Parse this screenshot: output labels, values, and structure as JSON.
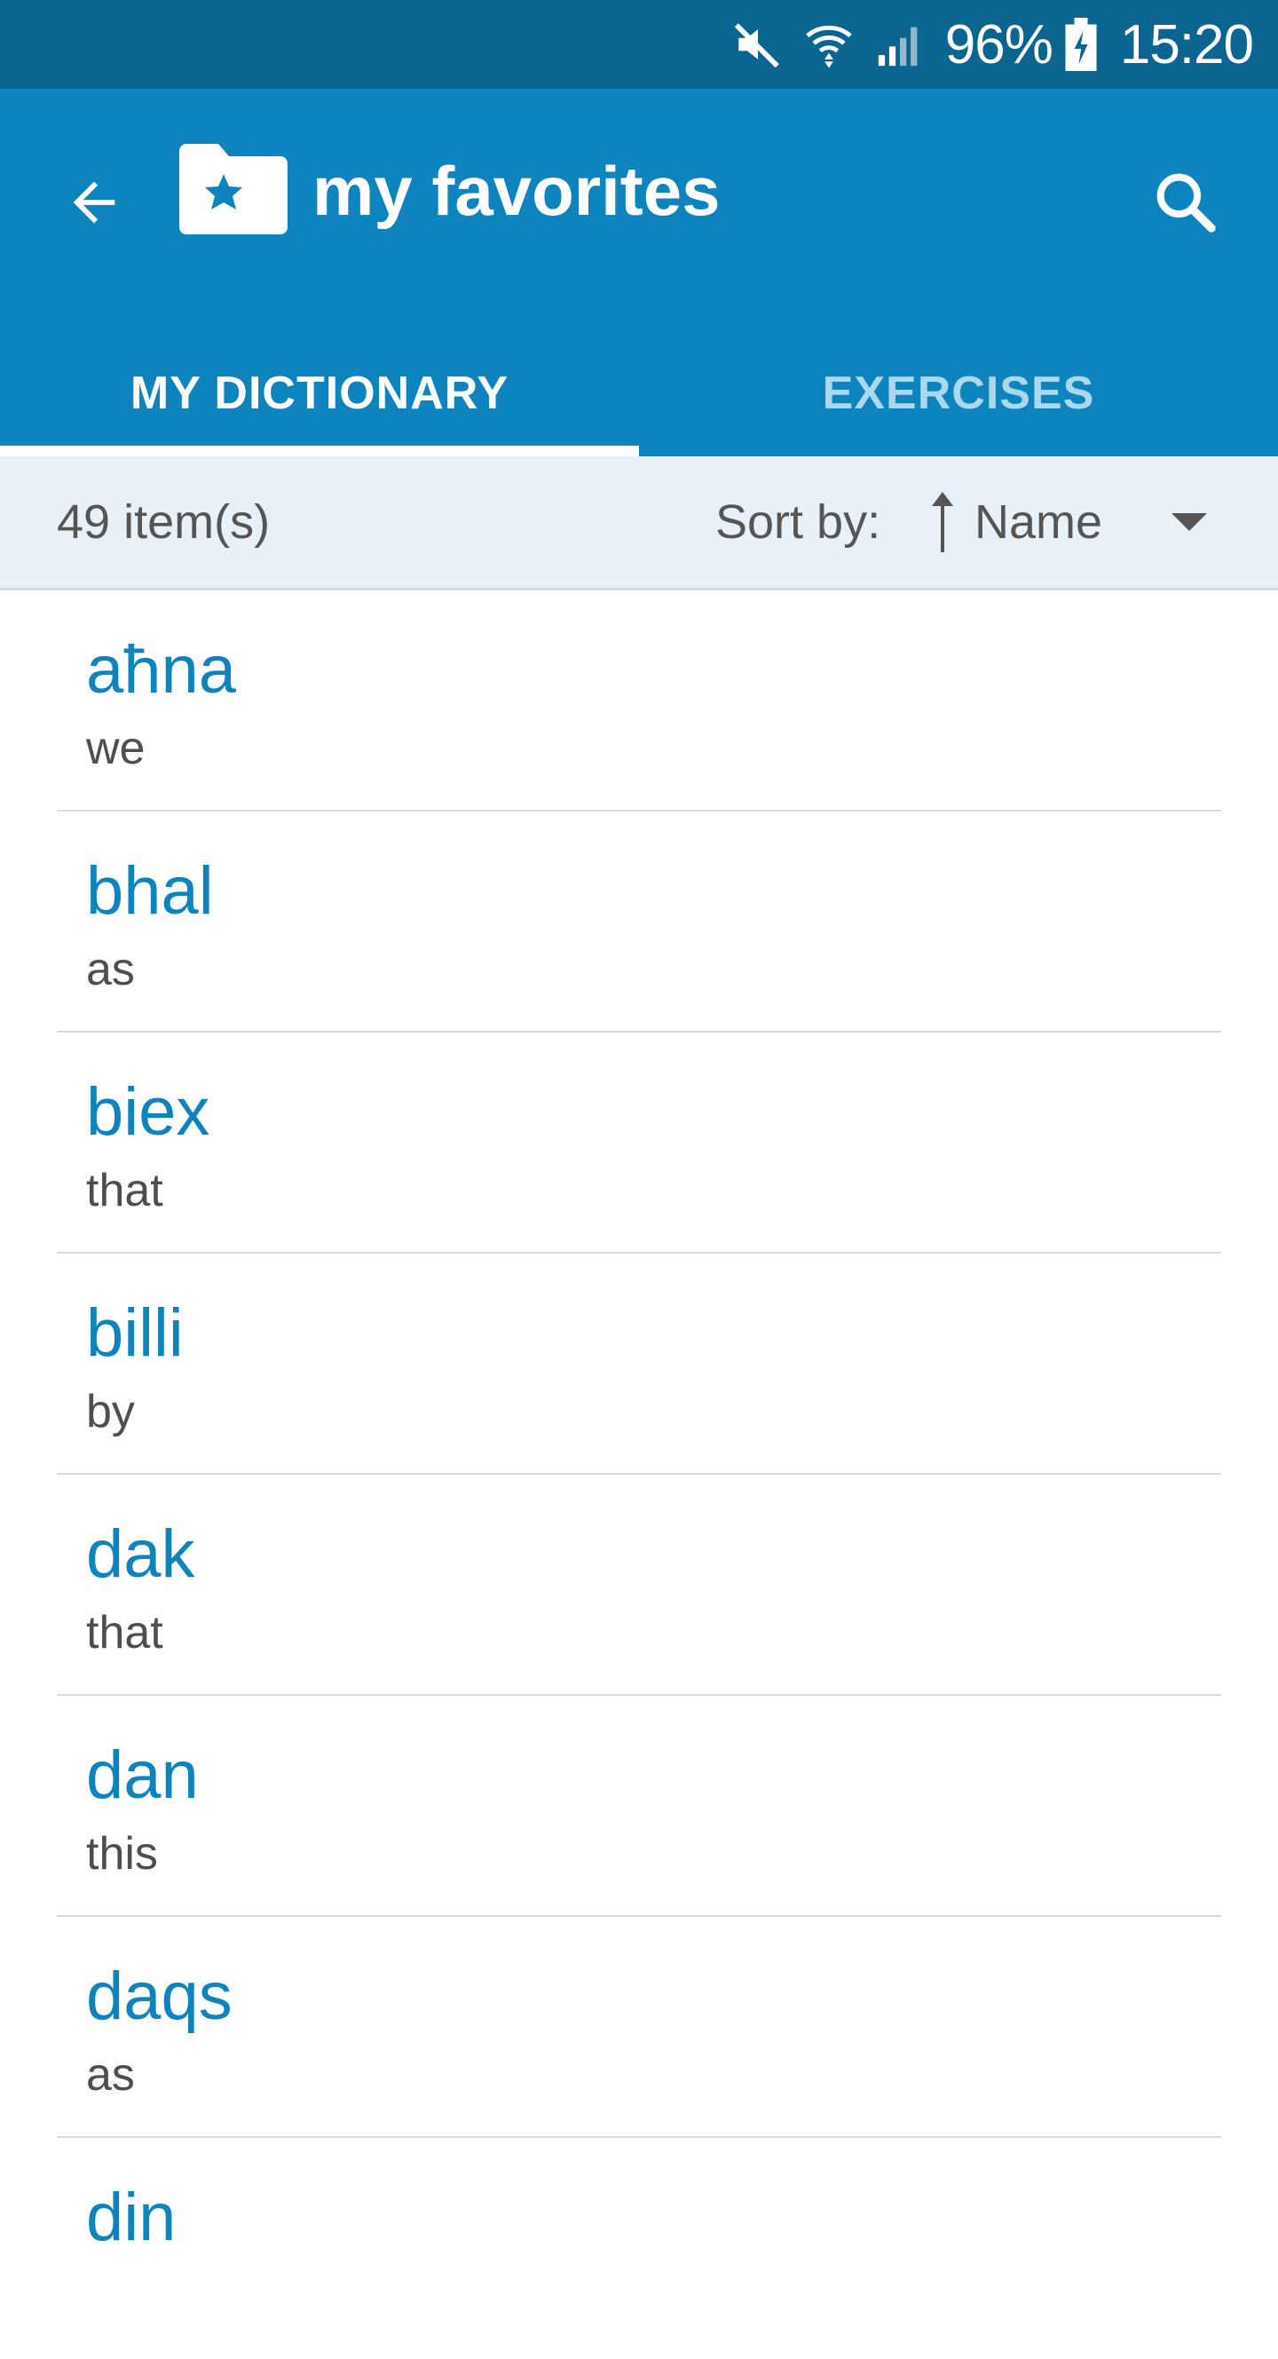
{
  "status": {
    "battery": "96%",
    "time": "15:20",
    "icons": [
      "mute-icon",
      "wifi-icon",
      "signal-icon",
      "battery-charging-icon"
    ]
  },
  "appbar": {
    "title": "my favorites",
    "background": "#0d84be",
    "icons": {
      "back": "arrow-left-icon",
      "folder": "folder-star-icon",
      "search": "search-icon"
    }
  },
  "tabs": [
    {
      "label": "MY DICTIONARY",
      "active": true
    },
    {
      "label": "EXERCISES",
      "active": false
    }
  ],
  "toolbar": {
    "count": "49 item(s)",
    "sort_label": "Sort by:",
    "sort_value": "Name",
    "sort_direction": "ascending"
  },
  "colors": {
    "status_bar": "#0b6591",
    "accent": "#0d84be",
    "toolbar_bg": "#e7f1f7"
  },
  "items": [
    {
      "word": "aħna",
      "translation": "we"
    },
    {
      "word": "bhal",
      "translation": "as"
    },
    {
      "word": "biex",
      "translation": "that"
    },
    {
      "word": "billi",
      "translation": "by"
    },
    {
      "word": "dak",
      "translation": "that"
    },
    {
      "word": "dan",
      "translation": "this"
    },
    {
      "word": "daqs",
      "translation": "as"
    },
    {
      "word": "din",
      "translation": ""
    }
  ]
}
